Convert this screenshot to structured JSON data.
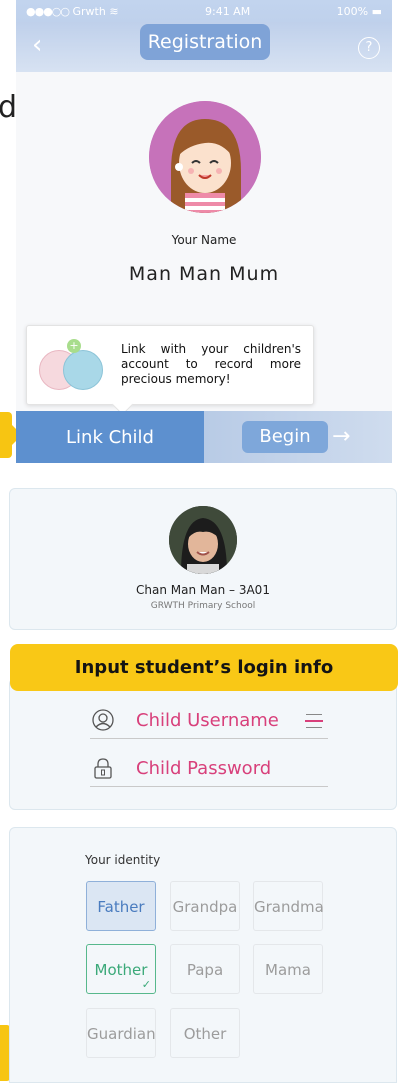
{
  "status_bar": {
    "carrier": "Grwth",
    "time": "9:41 AM",
    "battery": "100%"
  },
  "header": {
    "title": "Registration"
  },
  "profile": {
    "name_label": "Your Name",
    "name_value": "Man Man Mum"
  },
  "tooltip": {
    "text": "Link with your children's account to record more precious memory!"
  },
  "bottom_bar": {
    "link_child_label": "Link Child",
    "begin_label": "Begin"
  },
  "child_card": {
    "name": "Chan Man Man – 3A01",
    "school": "GRWTH Primary School"
  },
  "login": {
    "banner": "Input student’s login info",
    "username_placeholder": "Child Username",
    "password_placeholder": "Child Password"
  },
  "identity": {
    "label": "Your identity",
    "options": [
      "Father",
      "Grandpa",
      "Grandma",
      "Mother",
      "Papa",
      "Mama",
      "Guardian",
      "Other"
    ],
    "selected": [
      "Father",
      "Mother"
    ]
  },
  "colors": {
    "accent_blue": "#5d90cf",
    "banner_yellow": "#f9c816",
    "field_pink": "#d8407b",
    "selected_green": "#3ba979",
    "avatar_purple": "#c672ba"
  }
}
